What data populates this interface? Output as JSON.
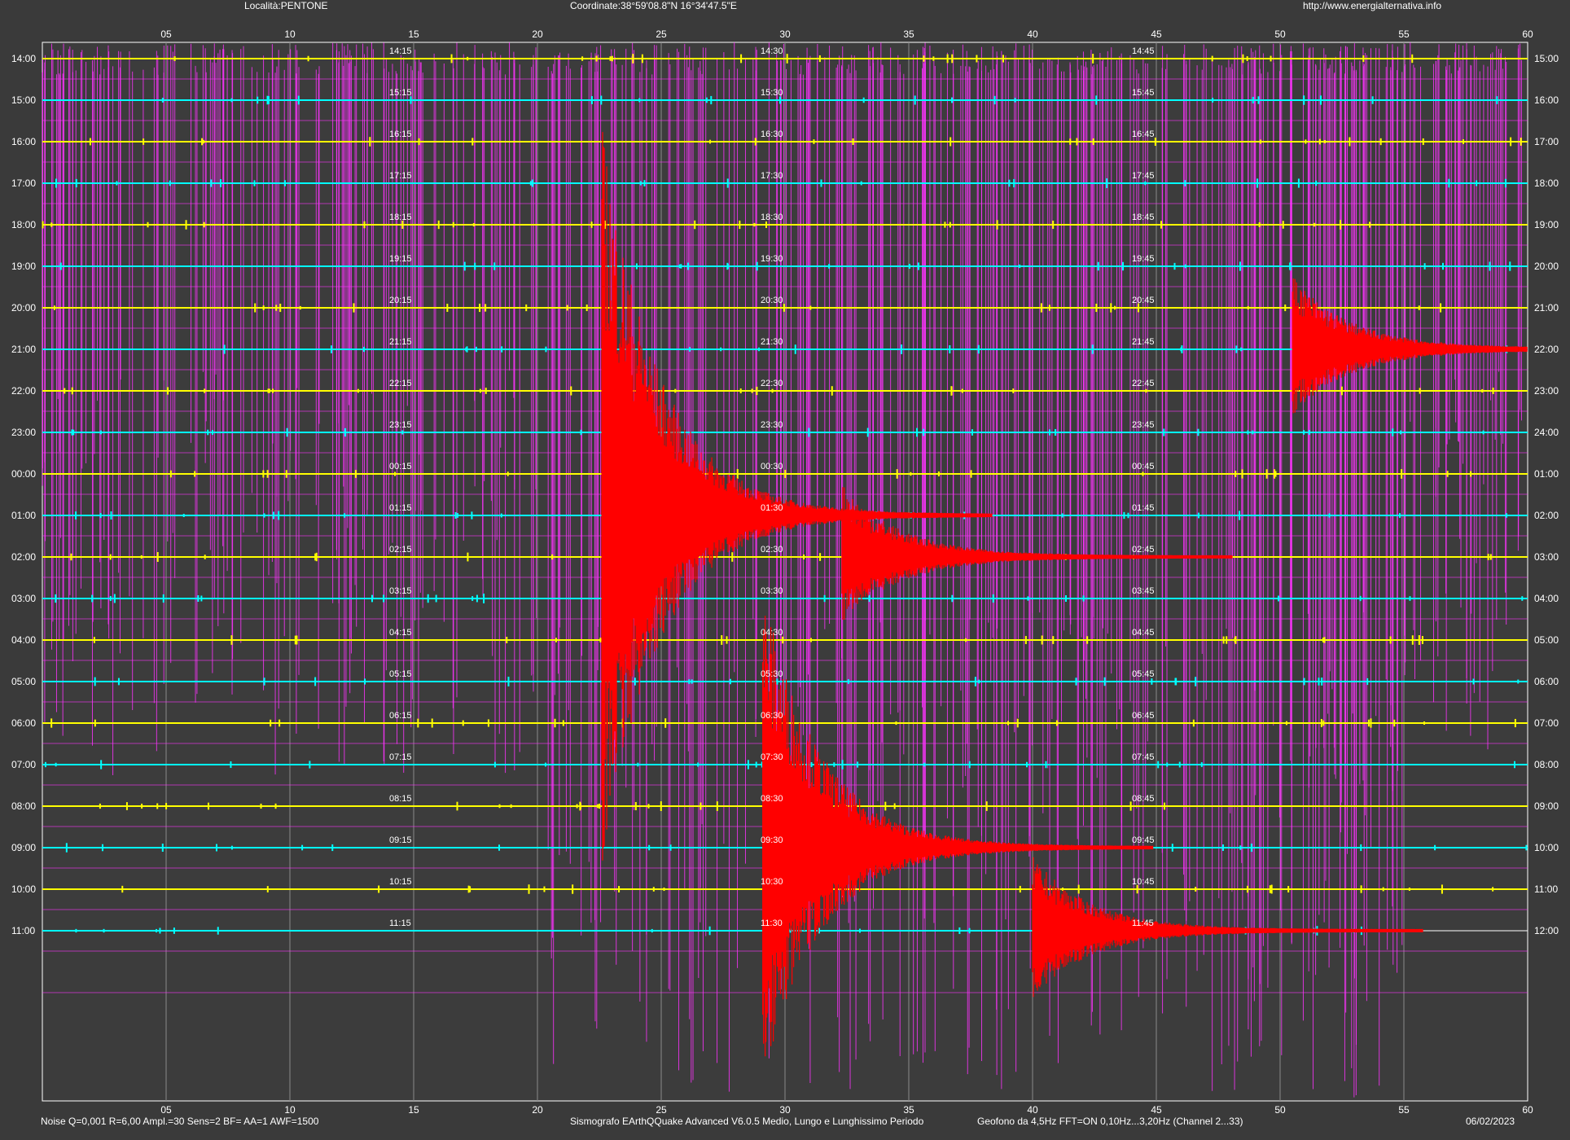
{
  "header": {
    "location": "Località:PENTONE",
    "coordinates": "Coordinate:38°59'08.8\"N  16°34'47.5\"E",
    "website": "http://www.energialternativa.info"
  },
  "footer": {
    "settings": "Noise Q=0,001 R=6,00 Ampl.=30 Sens=2 BF= AA=1 AWF=1500",
    "software": "Sismografo  EArthQQuake Advanced V6.0.5  Medio, Lungo e Lunghissimo Periodo",
    "sensor": "Geofono da 4,5Hz FFT=ON 0,10Hz...3,20Hz      (Channel 2...33)",
    "date": "06/02/2023"
  },
  "chart_data": {
    "type": "helicorder",
    "x_ticks": [
      "05",
      "10",
      "15",
      "20",
      "25",
      "30",
      "35",
      "40",
      "45",
      "50",
      "55",
      "60"
    ],
    "xlim": [
      0,
      60
    ],
    "left_labels": [
      "14:00",
      "15:00",
      "16:00",
      "17:00",
      "18:00",
      "19:00",
      "20:00",
      "21:00",
      "22:00",
      "23:00",
      "00:00",
      "01:00",
      "02:00",
      "03:00",
      "04:00",
      "05:00",
      "06:00",
      "07:00",
      "08:00",
      "09:00",
      "10:00",
      "11:00"
    ],
    "right_labels": [
      "15:00",
      "16:00",
      "17:00",
      "18:00",
      "19:00",
      "20:00",
      "21:00",
      "22:00",
      "23:00",
      "24:00",
      "01:00",
      "02:00",
      "03:00",
      "04:00",
      "05:00",
      "06:00",
      "07:00",
      "08:00",
      "09:00",
      "10:00",
      "11:00",
      "12:00"
    ],
    "marks_15": [
      "14:15",
      "15:15",
      "16:15",
      "17:15",
      "18:15",
      "19:15",
      "20:15",
      "21:15",
      "22:15",
      "23:15",
      "00:15",
      "01:15",
      "02:15",
      "03:15",
      "04:15",
      "05:15",
      "06:15",
      "07:15",
      "08:15",
      "09:15",
      "10:15",
      "11:15"
    ],
    "marks_30": [
      "14:30",
      "15:30",
      "16:30",
      "17:30",
      "18:30",
      "19:30",
      "20:30",
      "21:30",
      "22:30",
      "23:30",
      "00:30",
      "01:30",
      "02:30",
      "03:30",
      "04:30",
      "05:30",
      "06:30",
      "07:30",
      "08:30",
      "09:30",
      "10:30",
      "11:30"
    ],
    "marks_45": [
      "14:45",
      "15:45",
      "16:45",
      "17:45",
      "18:45",
      "19:45",
      "20:45",
      "21:45",
      "22:45",
      "23:45",
      "00:45",
      "01:45",
      "02:45",
      "03:45",
      "04:45",
      "05:45",
      "06:45",
      "07:45",
      "08:45",
      "09:45",
      "10:45",
      "11:45"
    ],
    "trace_colors": [
      "#ffff00",
      "#00ffff"
    ],
    "event_color": "#ff0000",
    "noise_color": "#ff33ff",
    "last_trace_end_minute": 54.8,
    "events": [
      {
        "row": 11,
        "minute": 22.6
      },
      {
        "row": 19,
        "minute": 29.1
      },
      {
        "row": 12,
        "minute": 32.3
      },
      {
        "row": 7,
        "minute": 50.5
      },
      {
        "row": 21,
        "minute": 40.0
      }
    ],
    "grid": true
  }
}
